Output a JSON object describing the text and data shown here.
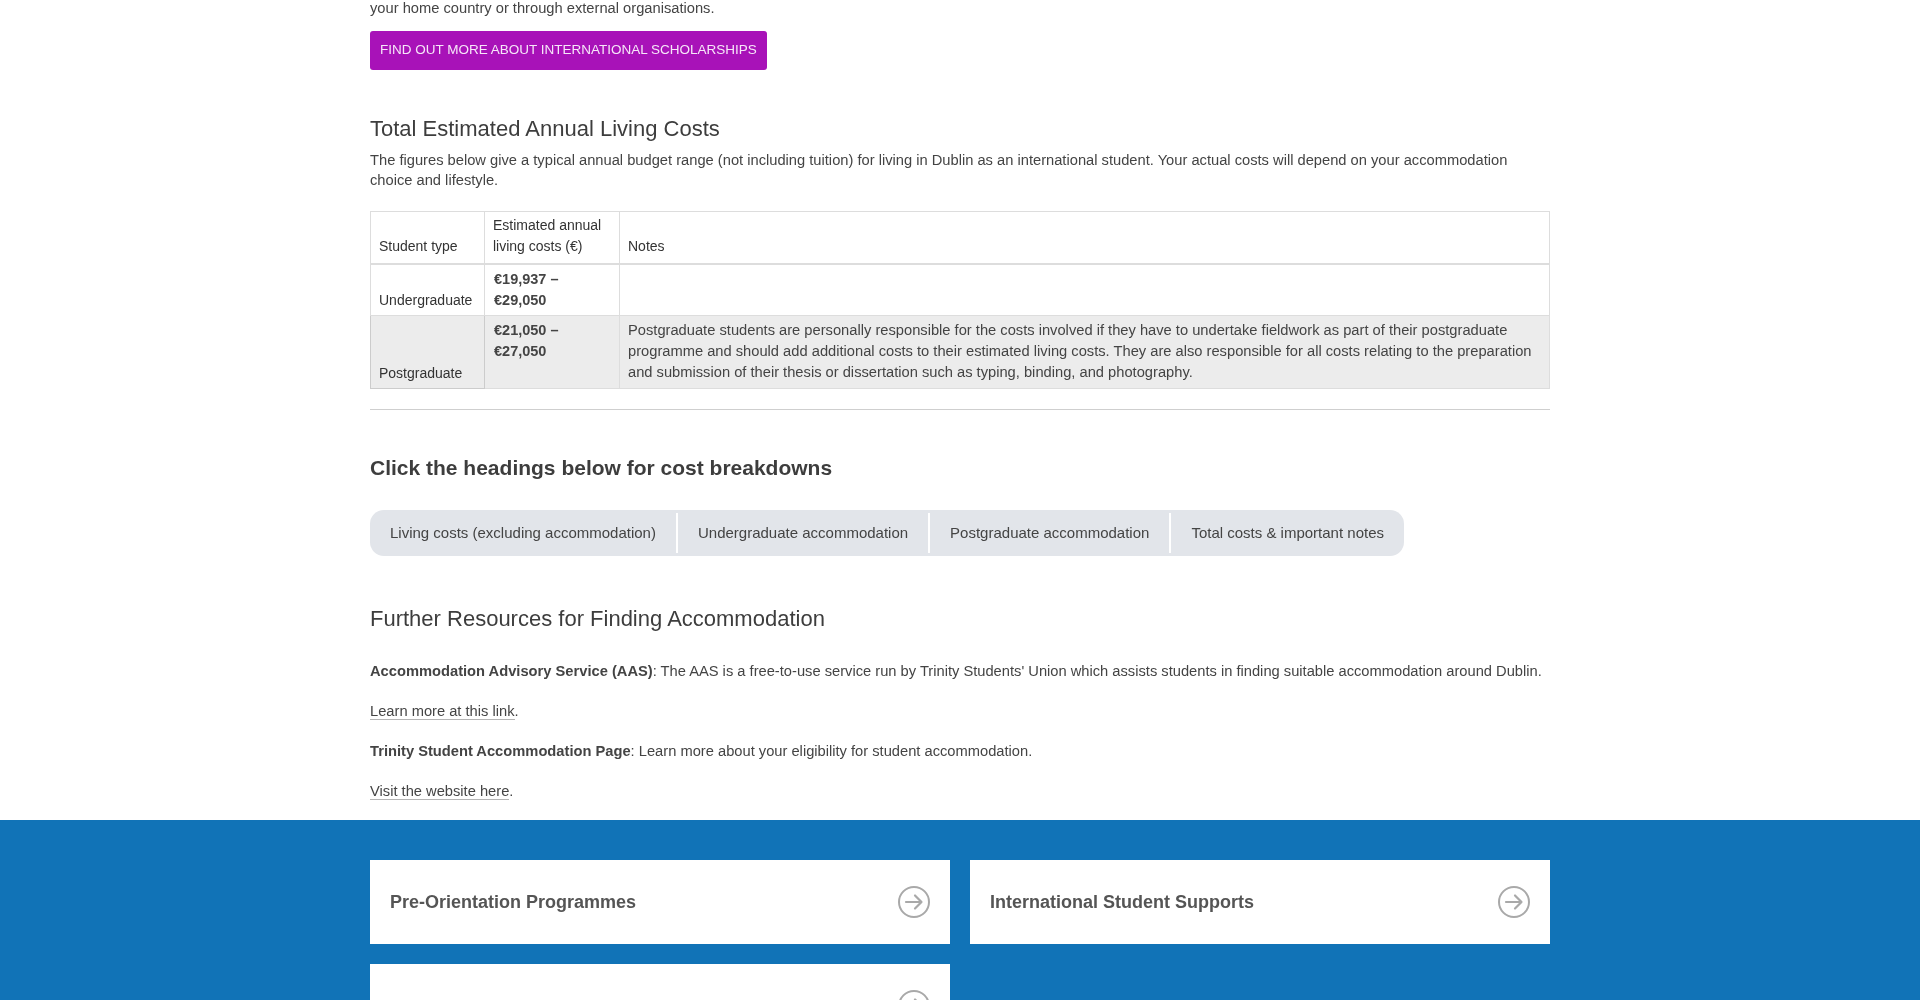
{
  "intro_text": "your home country or through external organisations.",
  "scholarships_button": {
    "label": "FIND OUT MORE ABOUT INTERNATIONAL SCHOLARSHIPS"
  },
  "living_costs": {
    "heading": "Total Estimated Annual Living Costs",
    "description": "The figures below give a typical annual budget range (not including tuition) for living in Dublin as an international student. Your actual costs will depend on your accommodation choice and lifestyle.",
    "table": {
      "columns": [
        "Student type",
        "Estimated annual living costs (€)",
        "Notes"
      ],
      "rows": [
        {
          "student_type": "Undergraduate",
          "cost": "€19,937 – €29,050"
        },
        {
          "student_type": "Postgraduate",
          "cost": "€21,050 – €27,050",
          "notes": "Postgraduate students are personally responsible for the costs involved if they have to undertake fieldwork as part of their postgraduate programme and should add additional costs to their estimated living costs. They are also responsible for all costs relating to the preparation and submission of their thesis or dissertation such as typing, binding, and photography."
        }
      ]
    }
  },
  "breakdowns": {
    "heading": "Click the headings below for cost breakdowns",
    "tabs": [
      {
        "label": "Living costs (excluding accommodation)",
        "selected": false
      },
      {
        "label": "Undergraduate accommodation",
        "selected": false
      },
      {
        "label": "Postgraduate accommodation",
        "selected": false
      },
      {
        "label": "Total costs & important notes",
        "selected": false
      }
    ]
  },
  "resources": {
    "heading": "Further Resources for Finding Accommodation",
    "paragraphs": [
      {
        "kind": "text",
        "text": "**Accommodation Advisory Service (AAS)**: The AAS is a free-to-use service run by Trinity Students' Union which assists students in finding suitable accommodation around Dublin."
      },
      {
        "kind": "link",
        "link": "Learn more at this link",
        "suffix": "."
      },
      {
        "kind": "text",
        "text": "**Trinity Student Accommodation Page**: Learn more about your eligibility for student accommodation."
      },
      {
        "kind": "link",
        "link": "Visit the website here",
        "suffix": "."
      }
    ]
  },
  "cards": [
    {
      "kind": "titled",
      "title": "Pre-Orientation Programmes"
    },
    {
      "kind": "titled",
      "title": "International Student Supports"
    },
    {
      "kind": "cut-off"
    }
  ]
}
